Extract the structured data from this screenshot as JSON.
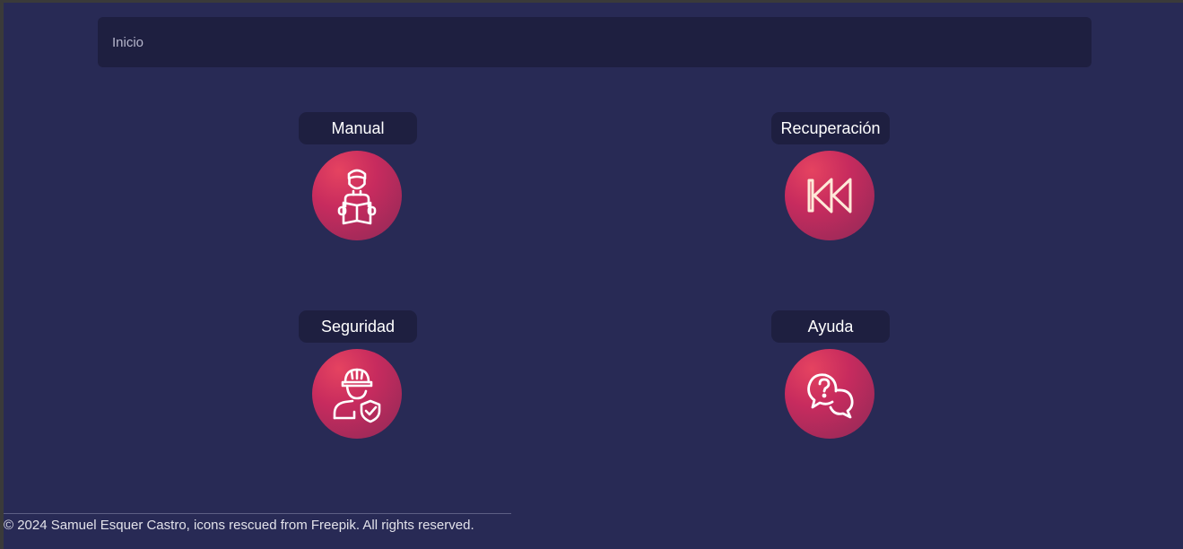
{
  "breadcrumb": {
    "items": [
      {
        "label": "Inicio"
      }
    ]
  },
  "tiles": [
    {
      "label": "Manual",
      "icon": "person-reading-book-icon"
    },
    {
      "label": "Recuperación",
      "icon": "rewind-icon"
    },
    {
      "label": "Seguridad",
      "icon": "worker-shield-icon"
    },
    {
      "label": "Ayuda",
      "icon": "question-chat-icon"
    }
  ],
  "footer": {
    "text": "© 2024 Samuel Esquer Castro, icons rescued from Freepik. All rights reserved."
  },
  "colors": {
    "background": "#282a55",
    "panel": "#1e1f40",
    "icon_gradient_start": "#e54360",
    "icon_gradient_end": "#8e2a57",
    "icon_stroke": "#ffffff"
  }
}
